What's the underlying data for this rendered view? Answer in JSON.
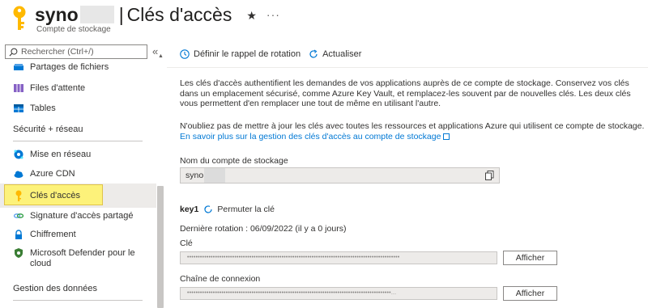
{
  "header": {
    "title_prefix": "syno",
    "separator": "|",
    "page_title": "Clés d'accès",
    "star_icon": "★",
    "more_icon": "···",
    "subtitle": "Compte de stockage"
  },
  "sidebar": {
    "search_placeholder": "Rechercher (Ctrl+/)",
    "collapse_icon": "«",
    "items_top": [
      {
        "label": "Partages de fichiers",
        "icon": "file-shares-icon"
      },
      {
        "label": "Files d'attente",
        "icon": "queues-icon"
      },
      {
        "label": "Tables",
        "icon": "tables-icon"
      }
    ],
    "section_security": "Sécurité + réseau",
    "items_security": [
      {
        "label": "Mise en réseau",
        "icon": "networking-icon"
      },
      {
        "label": "Azure CDN",
        "icon": "cdn-cloud-icon"
      },
      {
        "label": "Clés d'accès",
        "icon": "key-icon",
        "selected": true
      },
      {
        "label": "Signature d'accès partagé",
        "icon": "link-icon"
      },
      {
        "label": "Chiffrement",
        "icon": "lock-icon"
      },
      {
        "label": "Microsoft Defender pour le",
        "label2": "cloud",
        "icon": "shield-icon"
      }
    ],
    "section_data": "Gestion des données"
  },
  "toolbar": {
    "rotation_reminder": "Définir le rappel de rotation",
    "refresh": "Actualiser"
  },
  "main": {
    "description_1": "Les clés d'accès authentifient les demandes de vos applications auprès de ce compte de stockage. Conservez vos clés dans un emplacement sécurisé, comme Azure Key Vault, et remplacez-les souvent par de nouvelles clés. Les deux clés vous permettent d'en remplacer une tout de même en utilisant l'autre.",
    "description_2": "N'oubliez pas de mettre à jour les clés avec toutes les ressources et applications Azure qui utilisent ce compte de stockage.",
    "learn_more_link": "En savoir plus sur la gestion des clés d'accès au compte de stockage",
    "account_name_label": "Nom du compte de stockage",
    "account_name_value": "syno",
    "key1": {
      "name": "key1",
      "rotate_label": "Permuter la clé",
      "last_rotation": "Dernière rotation : 06/09/2022 (il y a 0 jours)",
      "key_label": "Clé",
      "key_masked": "•••••••••••••••••••••••••••••••••••••••••••••••••••••••••••••••••••••••••••••••••••••••••••••••••••",
      "show_key_button": "Afficher",
      "connection_label": "Chaîne de connexion",
      "connection_masked": "•••••••••••••••••••••••••••••••••••••••••••••••••••••••••••••••••••••••••••••••••••••••••••••••...",
      "show_connection_button": "Afficher"
    }
  },
  "colors": {
    "accent": "#0078d4",
    "key_gold": "#ffb900",
    "highlight": "#fdf27a"
  }
}
